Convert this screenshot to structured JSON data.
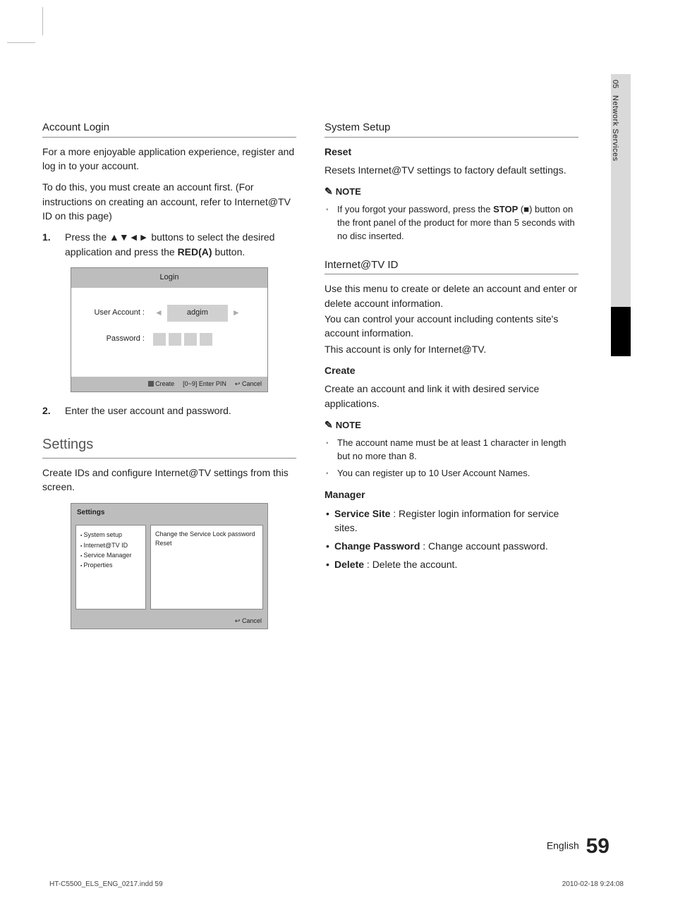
{
  "sideTab": {
    "num": "05",
    "label": "Network Services"
  },
  "left": {
    "accountLogin": {
      "title": "Account Login",
      "p1": "For a more enjoyable application experience, register and log in to your account.",
      "p2": "To do this, you must create an account first. (For instructions on creating an account, refer to Internet@TV ID on this page)",
      "step1_a": "Press the ",
      "step1_arrows": "▲▼◄►",
      "step1_b": " buttons to select the desired application and press the ",
      "step1_red": "RED(A)",
      "step1_c": " button.",
      "step2": "Enter the user account and password."
    },
    "loginBox": {
      "title": "Login",
      "userLabel": "User Account :",
      "userValue": "adgim",
      "passLabel": "Password :",
      "footCreate": "Create",
      "footPin": "[0~9] Enter PIN",
      "footCancel": "Cancel"
    },
    "settings": {
      "title": "Settings",
      "p1": "Create IDs and configure Internet@TV settings from this screen."
    },
    "settingsBox": {
      "head": "Settings",
      "menu1": "System setup",
      "menu2": "Internet@TV ID",
      "menu3": "Service Manager",
      "menu4": "Properties",
      "panelLine1": "Change the Service Lock password",
      "panelLine2": "Reset",
      "footCancel": "Cancel"
    }
  },
  "right": {
    "systemSetup": {
      "title": "System Setup",
      "resetHead": "Reset",
      "resetBody": "Resets Internet@TV settings to factory default settings.",
      "noteHead": "NOTE",
      "note1_a": "If you forgot your password, press the ",
      "note1_stop": "STOP",
      "note1_b": " (",
      "note1_c": ") button on the front panel of the product for more than 5 seconds with no disc inserted."
    },
    "internetId": {
      "title": "Internet@TV ID",
      "p1": "Use this menu to create or delete an account and enter or delete account information.",
      "p2": "You can control your account including contents site's account information.",
      "p3": "This account is only for Internet@TV.",
      "createHead": "Create",
      "createBody": "Create an account and link it with desired service applications.",
      "noteHead": "NOTE",
      "note1": "The account name must be at least 1 character in length but no more than 8.",
      "note2": "You can register up to 10 User Account Names.",
      "managerHead": "Manager",
      "m1_b": "Service Site",
      "m1_t": " : Register login information for service sites.",
      "m2_b": "Change Password",
      "m2_t": " : Change account password.",
      "m3_b": "Delete",
      "m3_t": " : Delete the account."
    }
  },
  "footer": {
    "lang": "English",
    "page": "59",
    "printFile": "HT-C5500_ELS_ENG_0217.indd   59",
    "printDate": "2010-02-18     9:24:08"
  }
}
